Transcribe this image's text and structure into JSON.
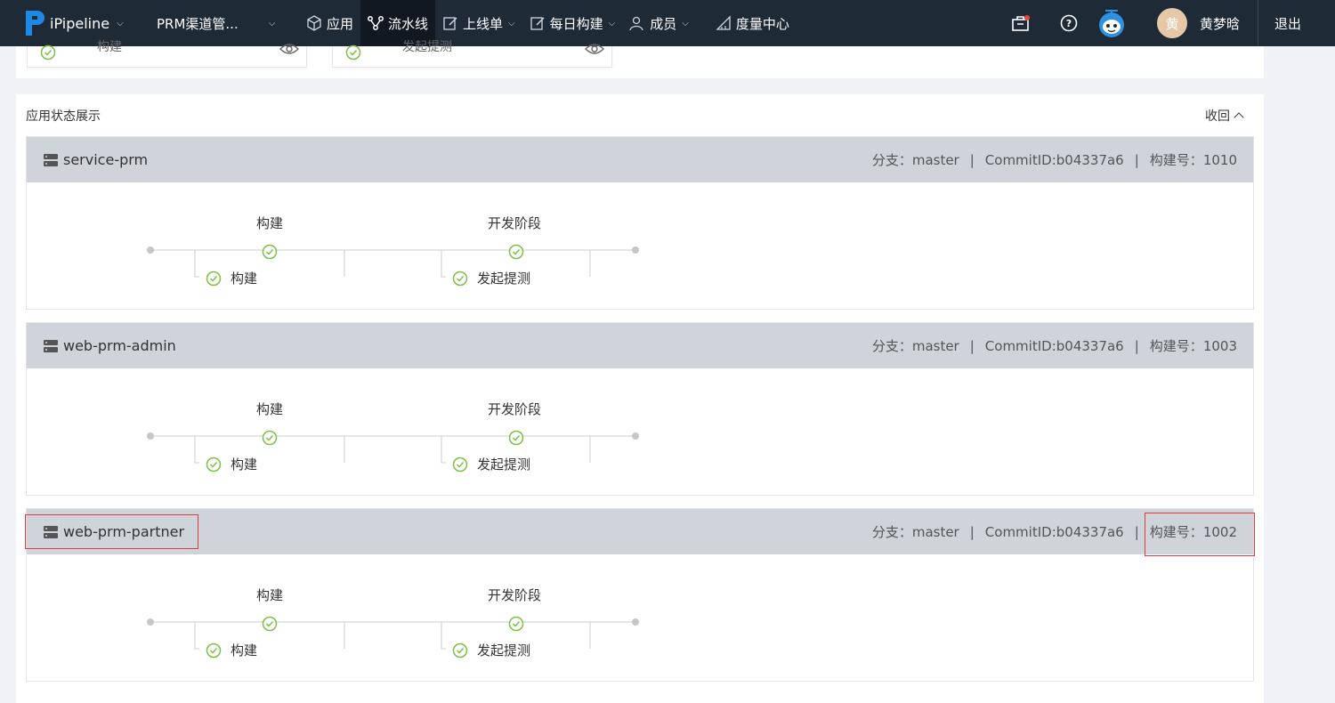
{
  "nav": {
    "brand": "iPipeline",
    "project": "PRM渠道管...",
    "items": [
      {
        "label": "应用",
        "icon": "cube-icon",
        "caret": false,
        "active": false
      },
      {
        "label": "流水线",
        "icon": "pipeline-icon",
        "caret": false,
        "active": true
      },
      {
        "label": "上线单",
        "icon": "edit-icon",
        "caret": true,
        "active": false
      },
      {
        "label": "每日构建",
        "icon": "edit-icon",
        "caret": true,
        "active": false
      },
      {
        "label": "成员",
        "icon": "users-icon",
        "caret": true,
        "active": false
      },
      {
        "label": "度量中心",
        "icon": "ruler-icon",
        "caret": false,
        "active": false
      }
    ],
    "avatar_text": "黄",
    "username": "黄梦晗",
    "logout": "退出"
  },
  "top_cards": [
    {
      "label": "构建"
    },
    {
      "label": "发起提测"
    }
  ],
  "panel": {
    "title": "应用状态展示",
    "collapse_label": "收回"
  },
  "meta_labels": {
    "branch": "分支：",
    "commit": "CommitID: ",
    "build": "构建号："
  },
  "apps": [
    {
      "name": "service-prm",
      "branch": "master",
      "commit": "b04337a6",
      "build": "1010"
    },
    {
      "name": "web-prm-admin",
      "branch": "master",
      "commit": "b04337a6",
      "build": "1003"
    },
    {
      "name": "web-prm-partner",
      "branch": "master",
      "commit": "b04337a6",
      "build": "1002"
    }
  ],
  "stages": [
    {
      "title": "构建",
      "job": "构建",
      "status": "success"
    },
    {
      "title": "开发阶段",
      "job": "发起提测",
      "status": "success"
    }
  ],
  "colors": {
    "nav_bg": "#1f2a37",
    "success": "#7ac143",
    "highlight": "#e03b3b",
    "app_header": "#cfd3da"
  }
}
